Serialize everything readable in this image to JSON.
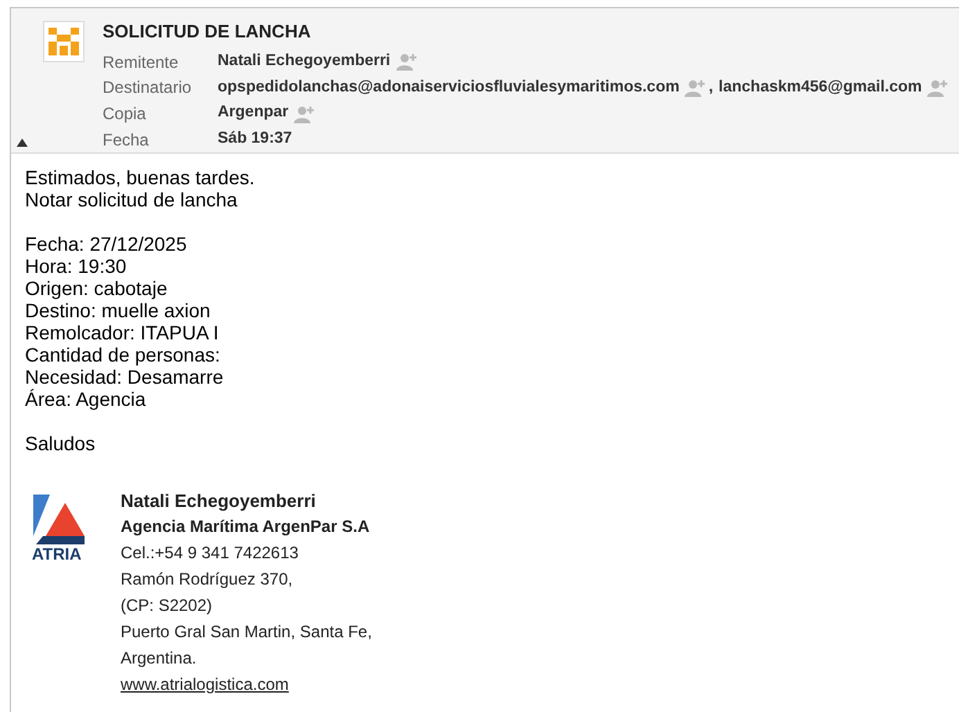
{
  "header": {
    "subject": "SOLICITUD DE LANCHA",
    "expanded": true,
    "fields": [
      {
        "label": "Remitente",
        "values": [
          "Natali Echegoyemberri"
        ]
      },
      {
        "label": "Destinatario",
        "separator": ",",
        "values": [
          "opspedidolanchas@adonaiserviciosfluvialesymaritimos.com",
          "lanchaskm456@gmail.com"
        ]
      },
      {
        "label": "Copia",
        "values": [
          "Argenpar"
        ]
      },
      {
        "label": "Fecha",
        "values": [
          "Sáb 19:37"
        ],
        "kind": "date"
      }
    ]
  },
  "body": {
    "paragraphs": [
      [
        "Estimados, buenas tardes.",
        "Notar solicitud de lancha"
      ],
      [
        "Fecha: 27/12/2025",
        "Hora: 19:30",
        "Origen: cabotaje",
        "Destino: muelle axion",
        "Remolcador: ITAPUA I",
        "Cantidad de personas:",
        "Necesidad: Desamarre",
        "Área: Agencia"
      ],
      [
        "Saludos"
      ]
    ]
  },
  "signature": {
    "logo_text": "ATRIA",
    "name": "Natali Echegoyemberri",
    "company": "Agencia Marítima ArgenPar S.A",
    "lines": [
      "Cel.:+54 9 341 7422613",
      "Ramón Rodríguez 370,",
      "(CP: S2202)",
      "Puerto Gral San Martin, Santa Fe,",
      "Argentina."
    ],
    "link": "www.atrialogistica.com"
  }
}
